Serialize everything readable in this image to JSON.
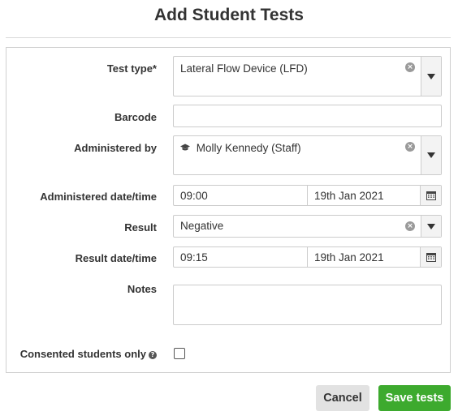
{
  "dialog": {
    "title": "Add Student Tests"
  },
  "form": {
    "test_type": {
      "label": "Test type*",
      "value": "Lateral Flow Device (LFD)"
    },
    "barcode": {
      "label": "Barcode",
      "value": ""
    },
    "administered_by": {
      "label": "Administered by",
      "value": "Molly Kennedy (Staff)",
      "icon": "graduation-cap-icon"
    },
    "administered_datetime": {
      "label": "Administered date/time",
      "time": "09:00",
      "date": "19th Jan 2021"
    },
    "result": {
      "label": "Result",
      "value": "Negative"
    },
    "result_datetime": {
      "label": "Result date/time",
      "time": "09:15",
      "date": "19th Jan 2021"
    },
    "notes": {
      "label": "Notes",
      "value": ""
    },
    "consented": {
      "label": "Consented students only",
      "checked": false
    }
  },
  "buttons": {
    "cancel": "Cancel",
    "save": "Save tests"
  },
  "colors": {
    "save_button": "#3daa2e",
    "cancel_button": "#e2e2e2"
  }
}
